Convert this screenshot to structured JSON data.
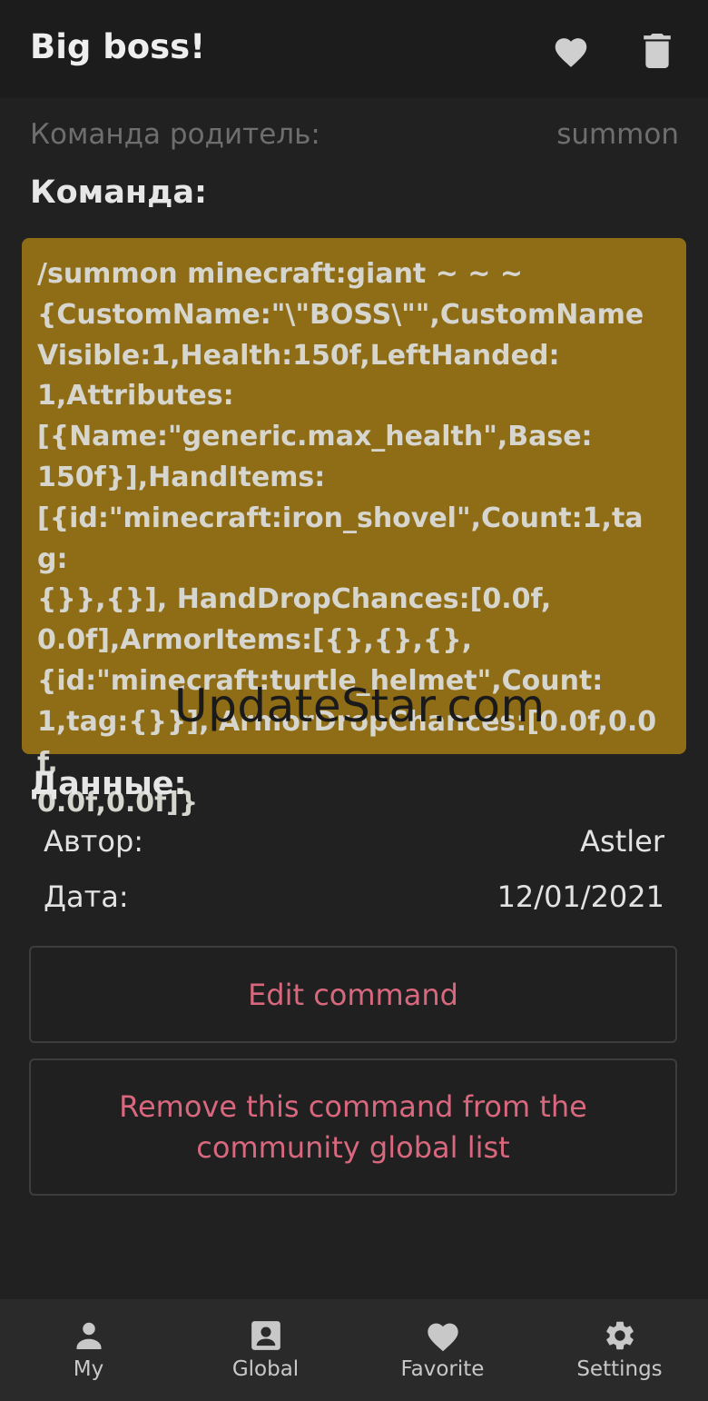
{
  "app_bar": {
    "title": "Big boss!",
    "favorite_icon": "heart-icon",
    "delete_icon": "trash-icon"
  },
  "parent": {
    "label": "Команда родитель:",
    "value": "summon"
  },
  "command": {
    "label": "Команда:",
    "lines": [
      "/summon minecraft:giant ~ ~ ~",
      "{CustomName:\"\\\"BOSS\\\"\",CustomName",
      "Visible:1,Health:150f,LeftHanded:",
      "1,Attributes:",
      "[{Name:\"generic.max_health\",Base:",
      "150f}],HandItems:",
      "[{id:\"minecraft:iron_shovel\",Count:1,tag:",
      "{}},{}], HandDropChances:[0.0f,",
      "0.0f],ArmorItems:[{},{},{},",
      "{id:\"minecraft:turtle_helmet\",Count:",
      "1,tag:{}}], ArmorDropChances:[0.0f,0.0f,",
      "0.0f,0.0f]}"
    ],
    "box_color": "#8f6d17"
  },
  "watermark": "UpdateStar.com",
  "data": {
    "label": "Данные:",
    "author_label": "Автор:",
    "author_value": "Astler",
    "date_label": "Дата:",
    "date_value": "12/01/2021"
  },
  "buttons": {
    "edit": "Edit command",
    "remove": "Remove this command from the community global list",
    "accent_color": "#d9687e"
  },
  "nav": {
    "items": [
      {
        "label": "My",
        "icon": "person-icon"
      },
      {
        "label": "Global",
        "icon": "account-box-icon"
      },
      {
        "label": "Favorite",
        "icon": "heart-icon"
      },
      {
        "label": "Settings",
        "icon": "gear-icon"
      }
    ]
  }
}
